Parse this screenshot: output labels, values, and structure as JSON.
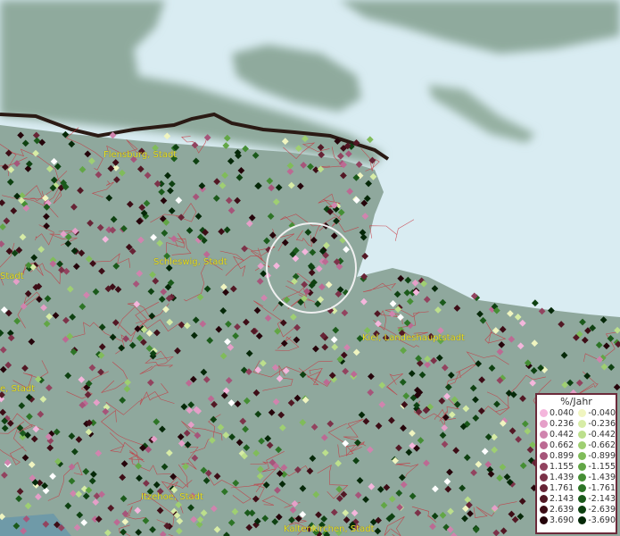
{
  "map": {
    "cities": [
      {
        "label": "Flensburg, Stadt"
      },
      {
        "label": "Schleswig, Stadt"
      },
      {
        "label": "Stadt"
      },
      {
        "label": "Kiel, Landeshauptstadt"
      },
      {
        "label": "e, Stadt"
      },
      {
        "label": "Itzehoe, Stadt"
      },
      {
        "label": "Kaltenkirchen, Stadt"
      }
    ]
  },
  "legend": {
    "title": "%/Jahr",
    "positive": [
      {
        "label": "0.040",
        "color": "#f4b6dc"
      },
      {
        "label": "0.236",
        "color": "#e59fc8"
      },
      {
        "label": "0.442",
        "color": "#d084ae"
      },
      {
        "label": "0.662",
        "color": "#bc6a93"
      },
      {
        "label": "0.899",
        "color": "#a6557a"
      },
      {
        "label": "1.155",
        "color": "#92435f"
      },
      {
        "label": "1.439",
        "color": "#7c3249"
      },
      {
        "label": "1.761",
        "color": "#672436"
      },
      {
        "label": "2.143",
        "color": "#521824"
      },
      {
        "label": "2.639",
        "color": "#3d0d16"
      },
      {
        "label": "3.690",
        "color": "#25040a"
      }
    ],
    "negative": [
      {
        "label": "-0.040",
        "color": "#f0f5c0"
      },
      {
        "label": "-0.236",
        "color": "#d7eca6"
      },
      {
        "label": "-0.442",
        "color": "#bcdf8c"
      },
      {
        "label": "-0.662",
        "color": "#9fcf72"
      },
      {
        "label": "-0.899",
        "color": "#80bc5a"
      },
      {
        "label": "-1.155",
        "color": "#62a646"
      },
      {
        "label": "-1.439",
        "color": "#458e34"
      },
      {
        "label": "-1.761",
        "color": "#2d7426"
      },
      {
        "label": "-2.143",
        "color": "#1b5a1b"
      },
      {
        "label": "-2.639",
        "color": "#0e4111"
      },
      {
        "label": "-3.690",
        "color": "#052808"
      }
    ]
  }
}
